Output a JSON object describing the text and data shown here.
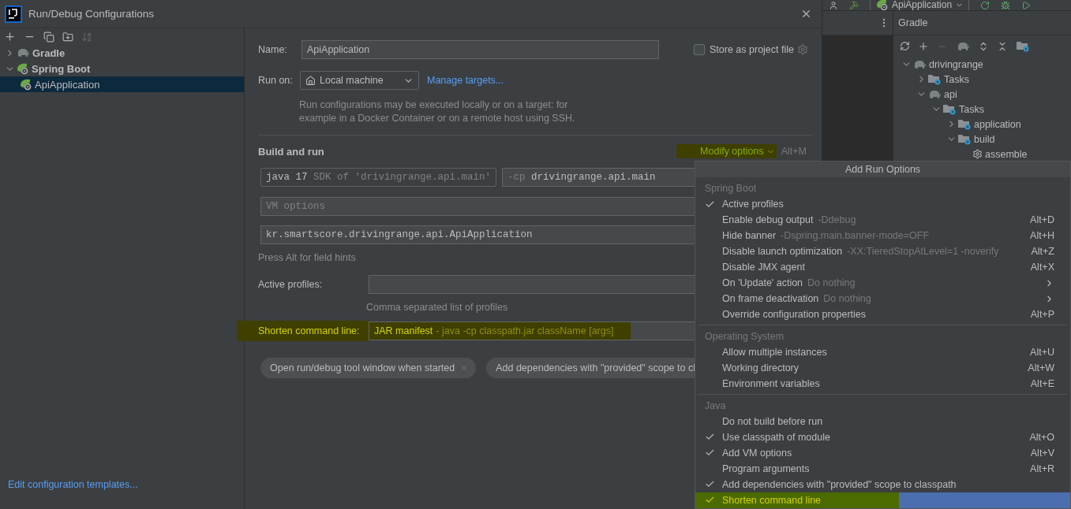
{
  "window": {
    "title": "Run/Debug Configurations"
  },
  "tree": [
    {
      "label": "Gradle",
      "kind": "gradle",
      "expanded": false,
      "selected": false
    },
    {
      "label": "Spring Boot",
      "kind": "spring",
      "expanded": true,
      "selected": false,
      "children": [
        {
          "label": "ApiApplication",
          "kind": "spring",
          "selected": true
        }
      ]
    }
  ],
  "templates_link": "Edit configuration templates...",
  "form": {
    "name_label": "Name:",
    "name_value": "ApiApplication",
    "store": {
      "label": "Store as project file",
      "checked": false
    },
    "run_on": {
      "label": "Run on:",
      "value": "Local machine",
      "link": "Manage targets..."
    },
    "run_on_help": "Run configurations may be executed locally or on a target: for example in a Docker Container or on a remote host using SSH.",
    "section_title": "Build and run",
    "modify_options": {
      "label": "Modify options",
      "shortcut": "Alt+M",
      "highlighted": true
    },
    "jre": {
      "version": "java 17",
      "detail": "SDK of 'drivingrange.api.main'"
    },
    "classpath": {
      "prefix": "-cp",
      "value": "drivingrange.api.main"
    },
    "vm_options": {
      "placeholder": "VM options"
    },
    "main_class": {
      "value": "kr.smartscore.drivingrange.api.ApiApplication"
    },
    "field_hint": "Press Alt for field hints",
    "active_profiles": {
      "label": "Active profiles:",
      "hint": "Comma separated list of profiles"
    },
    "shorten": {
      "label": "Shorten command line:",
      "value": "JAR manifest",
      "detail": "- java -cp classpath.jar className [args]",
      "highlighted": true
    },
    "chips": [
      {
        "label": "Open run/debug tool window when started",
        "closable": true
      },
      {
        "label": "Add dependencies with \"provided\" scope to cl",
        "closable": false
      }
    ]
  },
  "popup": {
    "title": "Add Run Options",
    "sections": [
      {
        "title": "Spring Boot",
        "items": [
          {
            "label": "Active profiles",
            "checked": true,
            "submenu": false,
            "selected": false
          },
          {
            "label": "Enable debug output",
            "hint": "-Ddebug",
            "shortcut": "Alt+D",
            "checked": false,
            "submenu": false,
            "selected": false
          },
          {
            "label": "Hide banner",
            "hint": "-Dspring.main.banner-mode=OFF",
            "shortcut": "Alt+H",
            "checked": false,
            "submenu": false,
            "selected": false
          },
          {
            "label": "Disable launch optimization",
            "hint": "-XX:TieredStopAtLevel=1 -noverify",
            "shortcut": "Alt+Z",
            "checked": false,
            "submenu": false,
            "selected": false
          },
          {
            "label": "Disable JMX agent",
            "shortcut": "Alt+X",
            "checked": false,
            "submenu": false,
            "selected": false
          },
          {
            "label": "On 'Update' action",
            "hint": "Do nothing",
            "checked": false,
            "submenu": true,
            "selected": false
          },
          {
            "label": "On frame deactivation",
            "hint": "Do nothing",
            "checked": false,
            "submenu": true,
            "selected": false
          },
          {
            "label": "Override configuration properties",
            "shortcut": "Alt+P",
            "checked": false,
            "submenu": false,
            "selected": false
          }
        ]
      },
      {
        "title": "Operating System",
        "items": [
          {
            "label": "Allow multiple instances",
            "shortcut": "Alt+U",
            "checked": false,
            "submenu": false,
            "selected": false
          },
          {
            "label": "Working directory",
            "shortcut": "Alt+W",
            "checked": false,
            "submenu": false,
            "selected": false
          },
          {
            "label": "Environment variables",
            "shortcut": "Alt+E",
            "checked": false,
            "submenu": false,
            "selected": false
          }
        ]
      },
      {
        "title": "Java",
        "items": [
          {
            "label": "Do not build before run",
            "checked": false,
            "submenu": false,
            "selected": false
          },
          {
            "label": "Use classpath of module",
            "shortcut": "Alt+O",
            "checked": true,
            "submenu": false,
            "selected": false
          },
          {
            "label": "Add VM options",
            "shortcut": "Alt+V",
            "checked": true,
            "submenu": false,
            "selected": false
          },
          {
            "label": "Program arguments",
            "shortcut": "Alt+R",
            "checked": false,
            "submenu": false,
            "selected": false
          },
          {
            "label": "Add dependencies with \"provided\" scope to classpath",
            "checked": true,
            "submenu": false,
            "selected": false
          },
          {
            "label": "Shorten command line",
            "checked": true,
            "submenu": false,
            "selected": true,
            "highlighted": true
          }
        ]
      }
    ]
  },
  "ide": {
    "run_config": "ApiApplication",
    "gradle": {
      "title": "Gradle",
      "tree": [
        {
          "label": "drivingrange",
          "kind": "project",
          "expanded": true,
          "children": [
            {
              "label": "Tasks",
              "kind": "folder",
              "expanded": false
            },
            {
              "label": "api",
              "kind": "project",
              "expanded": true,
              "children": [
                {
                  "label": "Tasks",
                  "kind": "folder",
                  "expanded": true,
                  "children": [
                    {
                      "label": "application",
                      "kind": "folder",
                      "expanded": false
                    },
                    {
                      "label": "build",
                      "kind": "folder",
                      "expanded": true,
                      "children": [
                        {
                          "label": "assemble",
                          "kind": "task"
                        }
                      ]
                    }
                  ]
                }
              ]
            }
          ]
        }
      ]
    }
  }
}
